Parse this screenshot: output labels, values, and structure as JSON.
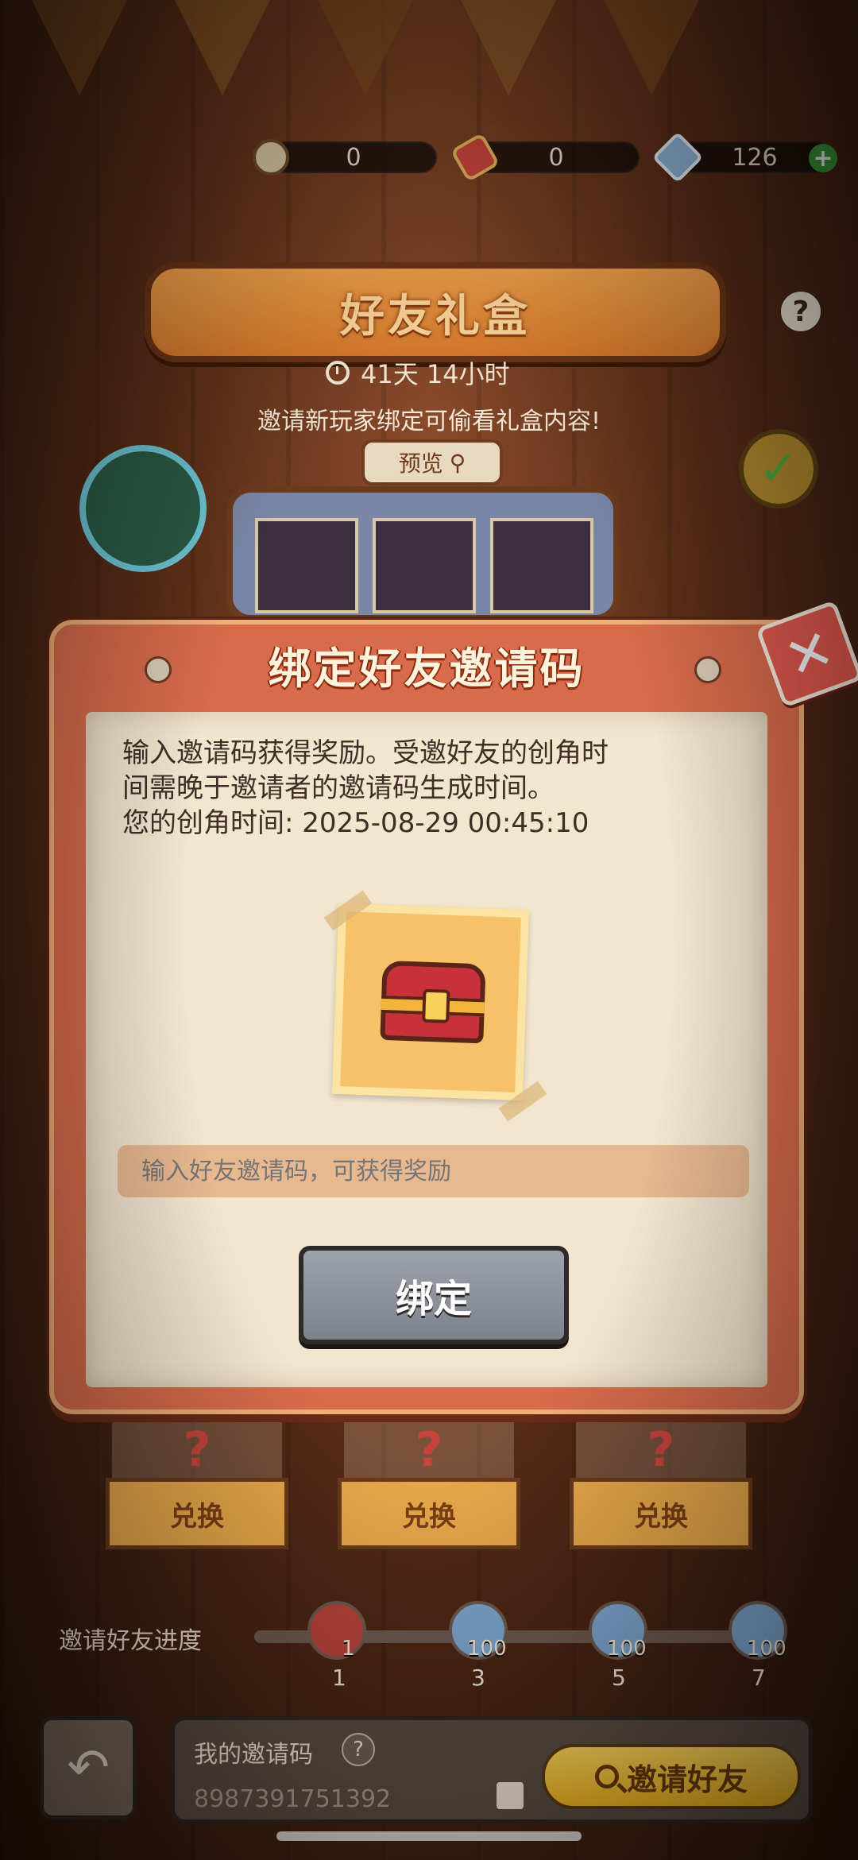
{
  "currencies": {
    "magnifier": "0",
    "scroll": "0",
    "gems": "126"
  },
  "event": {
    "title": "好友礼盒",
    "timer": "41天 14小时",
    "tip": "邀请新玩家绑定可偷看礼盒内容!",
    "preview_label": "预览"
  },
  "modal": {
    "title": "绑定好友邀请码",
    "description_line1": "输入邀请码获得奖励。受邀好友的创角时",
    "description_line2": "间需晚于邀请者的邀请码生成时间。",
    "description_line3": "您的创角时间: 2025-08-29 00:45:10",
    "input_placeholder": "输入好友邀请码，可获得奖励",
    "bind_button": "绑定"
  },
  "shelf": {
    "boxes": [
      {
        "label": "兑换"
      },
      {
        "label": "兑换"
      },
      {
        "label": "兑换"
      }
    ]
  },
  "progress": {
    "label": "邀请好友进度",
    "milestones": [
      {
        "reward": "1",
        "step": "1"
      },
      {
        "reward": "100",
        "step": "3"
      },
      {
        "reward": "100",
        "step": "5"
      },
      {
        "reward": "100",
        "step": "7"
      }
    ]
  },
  "bottom": {
    "my_code_label": "我的邀请码",
    "my_code": "8987391751392",
    "invite_button": "邀请好友"
  },
  "colors": {
    "modal": "#d76b4b",
    "paper": "#f2e6cf",
    "accent_yellow": "#ffd75a"
  }
}
